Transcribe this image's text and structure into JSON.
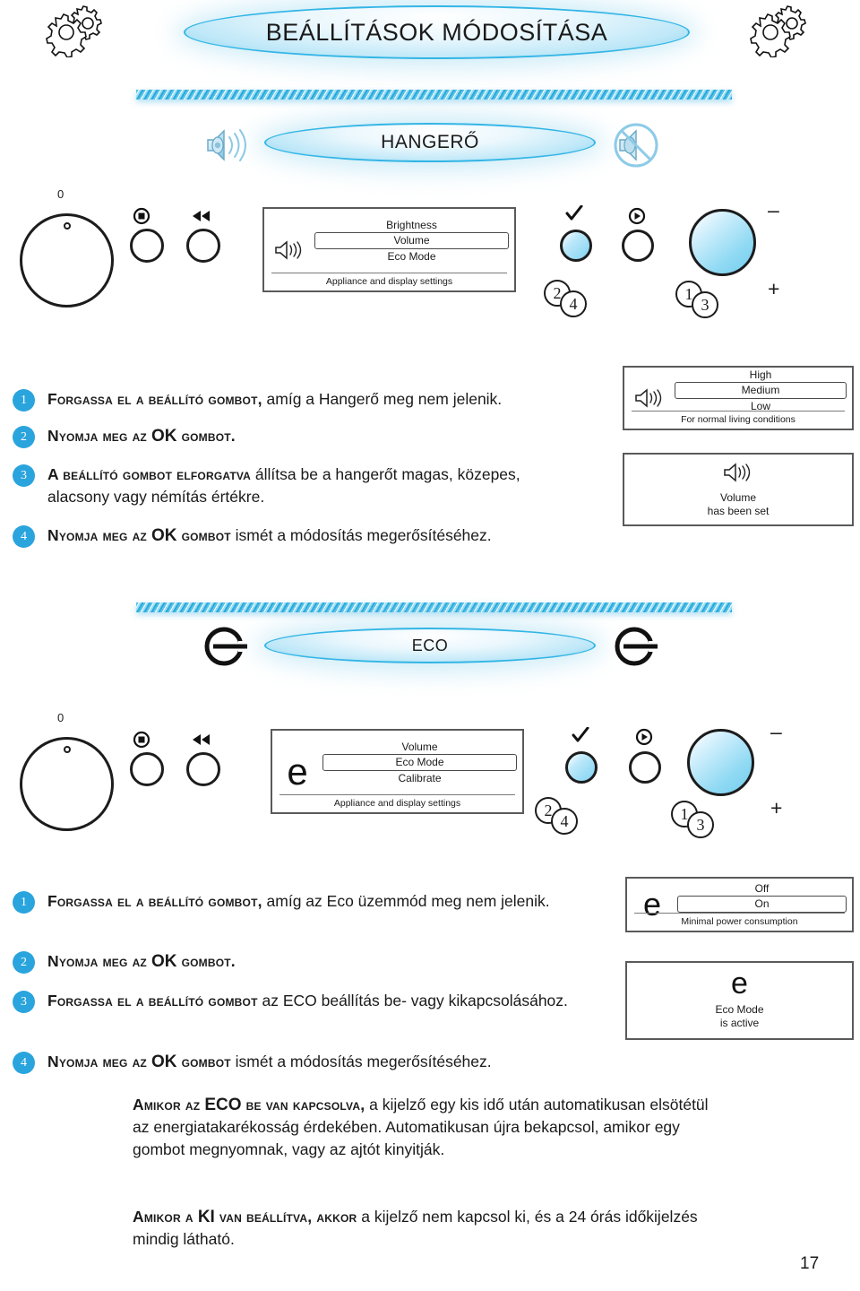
{
  "page": {
    "number": "17",
    "title": "BEÁLLÍTÁSOK MÓDOSÍTÁSA"
  },
  "sections": [
    {
      "id": "volume",
      "banner_label": "HANGERŐ",
      "left_icon": "speaker-on-icon",
      "right_icon": "speaker-muted-icon",
      "panel": {
        "knob_label": "0",
        "knob_name": "setting-knob",
        "buttons": [
          {
            "name": "stop-button",
            "icon": "stop-icon"
          },
          {
            "name": "rewind-button",
            "icon": "rewind-icon"
          },
          {
            "name": "ok-button",
            "icon": "check-icon",
            "highlight": true
          },
          {
            "name": "start-button",
            "icon": "play-icon"
          },
          {
            "name": "temperature-knob",
            "icon": "",
            "big": true
          }
        ],
        "markers": [
          "2",
          "4",
          "1",
          "3"
        ],
        "minus": "–",
        "plus": "+",
        "display": {
          "icon": "speaker-icon",
          "options": [
            "Brightness",
            "Volume",
            "Eco Mode"
          ],
          "selected": "Volume",
          "footer": "Appliance and display settings"
        }
      },
      "steps": [
        {
          "num": "1",
          "lead": "Forgassa el a beállító gombot,",
          "rest": " amíg a Hangerő meg nem jelenik."
        },
        {
          "num": "2",
          "lead": "Nyomja meg az ",
          "bold": "OK",
          "lead2": " gombot.",
          "rest": ""
        },
        {
          "num": "3",
          "lead": "A beállító gombot elforgatva",
          "rest": " állítsa be a hangerőt magas, közepes, alacsony vagy némítás értékre."
        },
        {
          "num": "4",
          "lead": "Nyomja meg az ",
          "bold": "OK",
          "lead2": " gombot",
          "rest": " ismét a módosítás megerősítéséhez."
        }
      ],
      "screens": [
        {
          "name": "volume-level-screen",
          "icon": "speaker-icon",
          "options": [
            "High",
            "Medium",
            "Low"
          ],
          "selected": "Medium",
          "footer": "For normal living conditions"
        },
        {
          "name": "volume-confirmed-screen",
          "icon": "speaker-icon",
          "message": [
            "Volume",
            "has been set"
          ]
        }
      ]
    },
    {
      "id": "eco",
      "banner_label": "ECO",
      "left_icon": "eco-e-icon",
      "right_icon": "eco-e-icon",
      "panel": {
        "knob_label": "0",
        "knob_name": "setting-knob",
        "markers": [
          "2",
          "4",
          "1",
          "3"
        ],
        "minus": "–",
        "plus": "+",
        "display": {
          "icon": "eco-e-icon",
          "options": [
            "Volume",
            "Eco Mode",
            "Calibrate"
          ],
          "selected": "Eco Mode",
          "footer": "Appliance and display settings"
        }
      },
      "steps": [
        {
          "num": "1",
          "lead": "Forgassa el a beállító gombot,",
          "rest": " amíg az Eco üzemmód meg nem jelenik."
        },
        {
          "num": "2",
          "lead": "Nyomja meg az ",
          "bold": "OK",
          "lead2": " gombot.",
          "rest": ""
        },
        {
          "num": "3",
          "lead": "Forgassa el a beállító gombot",
          "rest": " az ECO beállítás be- vagy kikapcsolásához."
        },
        {
          "num": "4",
          "lead": "Nyomja meg az ",
          "bold": "OK",
          "lead2": " gombot",
          "rest": " ismét a módosítás megerősítéséhez."
        }
      ],
      "screens": [
        {
          "name": "eco-state-screen",
          "icon": "eco-e-icon",
          "options": [
            "Off",
            "On"
          ],
          "selected": "On",
          "footer": "Minimal power consumption"
        },
        {
          "name": "eco-confirmed-screen",
          "icon": "eco-e-icon",
          "message": [
            "Eco Mode",
            "is active"
          ]
        }
      ]
    }
  ],
  "note": {
    "p1_lead": "Amikor az ",
    "p1_bold": "ECO",
    "p1_lead2": " be van kapcsolva,",
    "p1_rest": " a kijelző egy kis idő után automatikusan elsötétül az energiatakarékosság érdekében. Automatikusan újra bekapcsol, amikor egy gombot megnyomnak, vagy az ajtót kinyitják.",
    "p2_lead": "Amikor a ",
    "p2_bold": "KI",
    "p2_lead2": " van beállítva, akkor",
    "p2_rest": " a kijelző nem kapcsol ki, és a 24 órás időkijelzés mindig látható."
  },
  "colors": {
    "accent": "#2aa4dd",
    "banner_border": "#32b5e5",
    "ink": "#1a1a1a"
  }
}
